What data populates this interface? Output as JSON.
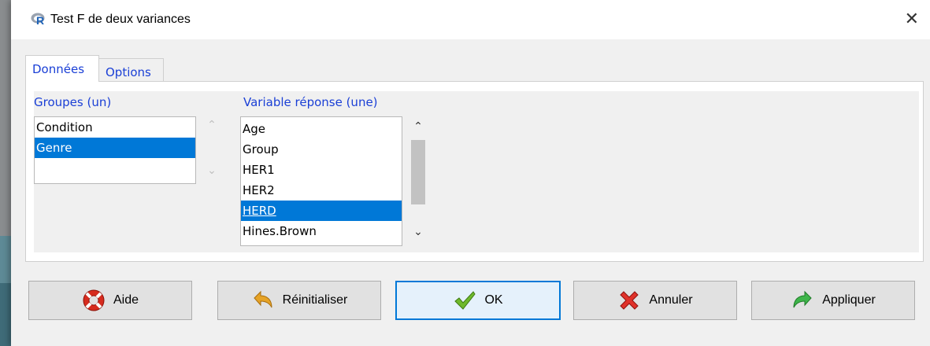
{
  "window": {
    "title": "Test F de deux variances"
  },
  "tabs": [
    {
      "label": "Données",
      "active": true
    },
    {
      "label": "Options",
      "active": false
    }
  ],
  "groups": {
    "label": "Groupes (un)",
    "items": [
      "Condition",
      "Genre"
    ],
    "selected": "Genre"
  },
  "response": {
    "label": "Variable réponse (une)",
    "items": [
      "Age",
      "Group",
      "HER1",
      "HER2",
      "HERD",
      "Hines.Brown"
    ],
    "selected": "HERD"
  },
  "buttons": {
    "help": "Aide",
    "reset": "Réinitialiser",
    "ok": "OK",
    "cancel": "Annuler",
    "apply": "Appliquer"
  },
  "colors": {
    "accent": "#0078d7",
    "label_blue": "#1a3fd6",
    "window_bg": "#f0f0f0"
  },
  "icons": {
    "app": "r-logo-icon",
    "close": "close-icon",
    "help": "lifebuoy-icon",
    "reset": "undo-arrow-icon",
    "ok": "checkmark-icon",
    "cancel": "red-x-icon",
    "apply": "green-arrow-icon"
  }
}
